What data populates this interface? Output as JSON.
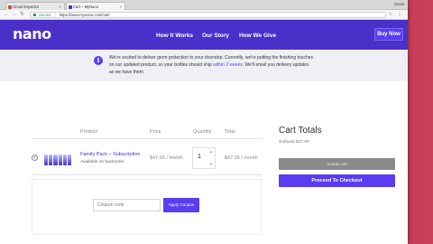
{
  "browser": {
    "tabs": [
      {
        "label": "Gmail inspector",
        "fav_color": "#d14836"
      },
      {
        "label": "Cart – MyNano",
        "fav_color": "#4b2fc9"
      }
    ],
    "user_label": "Devin",
    "url_secure_label": "Secure",
    "url": "https://www.mynano.com/cart/",
    "back_icon": "back-arrow-icon",
    "forward_icon": "forward-arrow-icon",
    "reload_icon": "reload-icon"
  },
  "header": {
    "logo": "nano",
    "nav": [
      "How It Works",
      "Our Story",
      "How We Give"
    ],
    "buy_now": "Buy Now",
    "brand_color": "#4b2fc9",
    "accent_color": "#5a3df0"
  },
  "notice": {
    "text_before": "We're excited to deliver germ protection to your doorstep. Currently, we're putting the finishing touches on our updated product, so your bottles should ship ",
    "highlight": "within 2 weeks",
    "text_after": ". We'll email you delivery updates as we have them."
  },
  "cart": {
    "columns": [
      "Product",
      "Price",
      "Quantity",
      "Total"
    ],
    "item": {
      "name": "Family Pack – Subscription",
      "availability": "Available on backorder",
      "price": "$47.99 / month",
      "quantity": "1",
      "total": "$47.99 / month"
    },
    "coupon_placeholder": "Coupon code",
    "apply_coupon": "Apply Coupon"
  },
  "totals": {
    "title": "Cart Totals",
    "subtotal": "Subtotal $47.99",
    "update_cart": "Update cart",
    "checkout": "Proceed To Checkout"
  }
}
